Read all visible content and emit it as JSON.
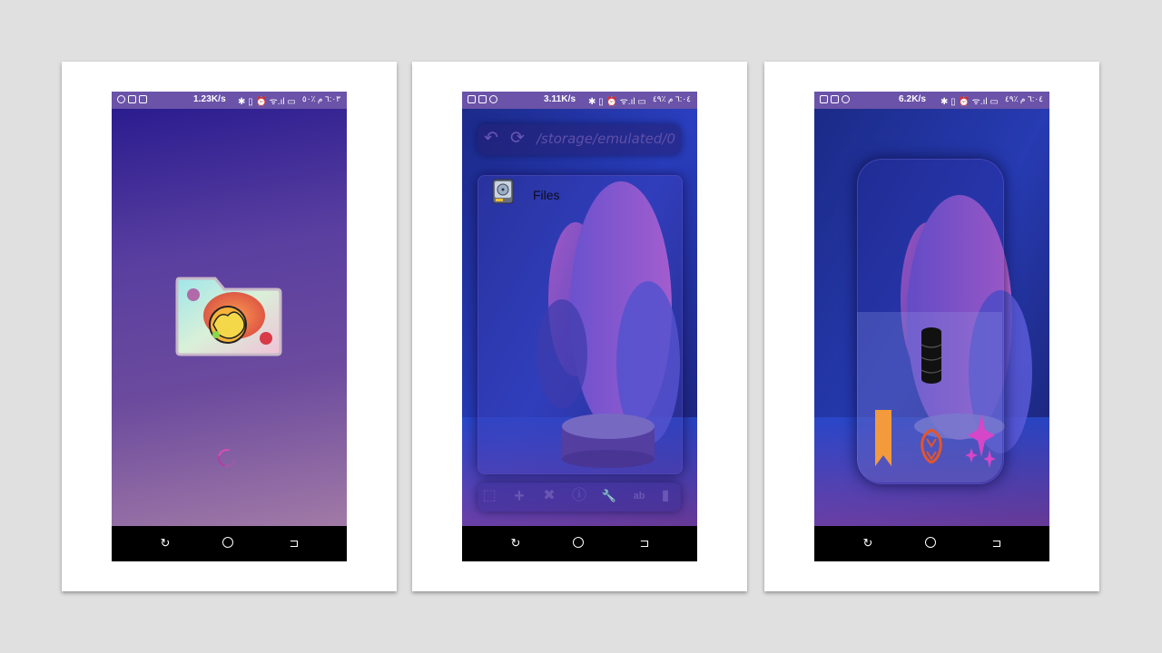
{
  "colors": {
    "background": "#e0e0e0",
    "status_bar": "#6a53a8",
    "accent_pink": "#e04bb6",
    "bookmark_orange": "#f29a3c",
    "icon_purple": "#6a57b4"
  },
  "screens": [
    {
      "name": "splash",
      "status": {
        "speed": "1.23K/s",
        "icons": "✱ ▯ ⏰ ᯤ.ıl ▭",
        "time": "٦:٠٣ م ٪٥٠"
      },
      "icon": "app-folder-logo",
      "spinner": "loading-spinner"
    },
    {
      "name": "file-browser",
      "status": {
        "speed": "3.11K/s",
        "icons": "✱ ▯ ⏰ ᯤ.ıl ▭",
        "time": "٦:٠٤ م ٪٤٩"
      },
      "path": "/storage/emulated/0",
      "files": [
        {
          "label": "Files",
          "icon": "hard-drive-icon"
        }
      ],
      "toolbar": [
        {
          "name": "select-all-icon",
          "glyph": "⬚"
        },
        {
          "name": "add-icon",
          "glyph": "+"
        },
        {
          "name": "delete-icon",
          "glyph": "✖"
        },
        {
          "name": "info-icon",
          "glyph": "ⓘ"
        },
        {
          "name": "tools-icon",
          "glyph": "🔧"
        },
        {
          "name": "rename-icon",
          "glyph": "ab"
        },
        {
          "name": "bookmark-icon",
          "glyph": "▮"
        }
      ]
    },
    {
      "name": "side-menu",
      "status": {
        "speed": "6.2K/s",
        "icons": "✱ ▯ ⏰ ᯤ.ıl ▭",
        "time": "٦:٠٤ م ٪٤٩"
      },
      "menu": [
        {
          "name": "storage-icon"
        },
        {
          "name": "bookmark-icon"
        },
        {
          "name": "recycle-icon"
        },
        {
          "name": "sparkles-icon"
        }
      ]
    }
  ],
  "navbar": {
    "back": "↻",
    "recent": "⊐"
  }
}
